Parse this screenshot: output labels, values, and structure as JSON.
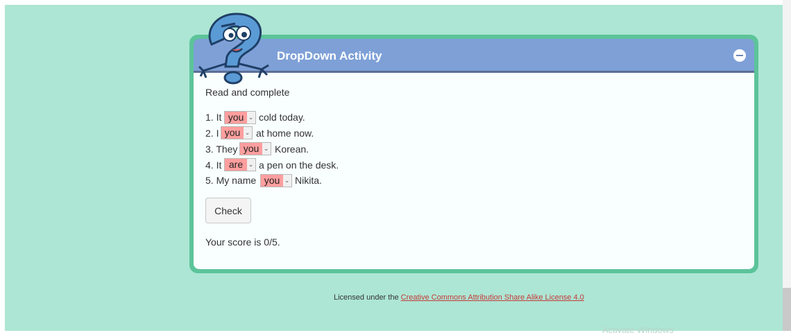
{
  "activity": {
    "title": "DropDown Activity",
    "instruction": "Read and complete",
    "items": [
      {
        "prefix": "1. It",
        "selected": "you",
        "suffix": "cold today."
      },
      {
        "prefix": "2. I",
        "selected": "you",
        "suffix": "at home now."
      },
      {
        "prefix": "3. They",
        "selected": "you",
        "suffix": "Korean."
      },
      {
        "prefix": "4. It",
        "selected": "are",
        "suffix": "a pen on the desk."
      },
      {
        "prefix": "5. My name",
        "selected": "you",
        "suffix": "Nikita."
      }
    ],
    "check_label": "Check",
    "score_text": "Your score is 0/5."
  },
  "footer": {
    "license_prefix": "Licensed under the ",
    "license_link": "Creative Commons Attribution Share Alike License 4.0"
  },
  "watermark": "Activate Windows",
  "icons": {
    "mascot": "question-mark-mascot-icon",
    "minimize": "minus-circle-icon",
    "dropdown_arrow": "chevron-down-icon"
  },
  "colors": {
    "background": "#ade6d4",
    "box_border": "#5cc49a",
    "header": "#7ea0d7",
    "wrong_answer": "#ff9e9e",
    "link": "#c43a3a"
  }
}
